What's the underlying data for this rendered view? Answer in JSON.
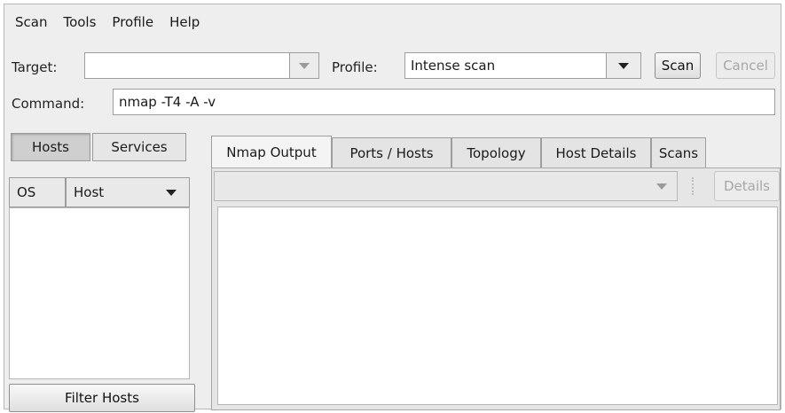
{
  "menu": [
    "Scan",
    "Tools",
    "Profile",
    "Help"
  ],
  "toolbar": {
    "target_label": "Target:",
    "target_value": "",
    "profile_label": "Profile:",
    "profile_value": "Intense scan",
    "scan_button": "Scan",
    "cancel_button": "Cancel",
    "command_label": "Command:",
    "command_value": "nmap -T4 -A -v"
  },
  "left_panel": {
    "hosts_toggle": "Hosts",
    "services_toggle": "Services",
    "col_os": "OS",
    "col_host": "Host",
    "filter_button": "Filter Hosts"
  },
  "tabs": [
    "Nmap Output",
    "Ports / Hosts",
    "Topology",
    "Host Details",
    "Scans"
  ],
  "output": {
    "host_select_value": "",
    "details_button": "Details"
  }
}
